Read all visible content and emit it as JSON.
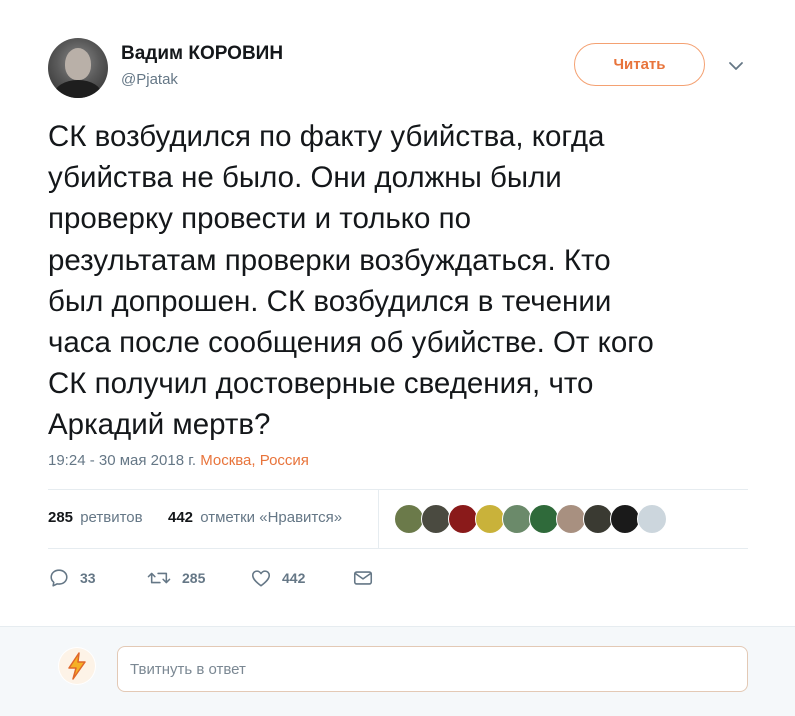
{
  "user": {
    "name": "Вадим КОРОВИН",
    "handle": "@Pjatak"
  },
  "follow_button": {
    "label": "Читать"
  },
  "tweet": {
    "lines": [
      "СК возбудился по факту убийства, когда",
      "убийства не было. Они должны были",
      "проверку провести и только по",
      "результатам проверки возбуждаться. Кто",
      "был допрошен. СК возбудился в течении",
      "часа после сообщения об убийстве. От кого",
      "СК получил достоверные сведения, что",
      "Аркадий мертв?"
    ],
    "timestamp": "19:24 - 30 мая 2018 г.",
    "location": "Москва, Россия"
  },
  "stats": {
    "retweets_count": "285",
    "retweets_label": "ретвитов",
    "likes_count": "442",
    "likes_label": "отметки «Нравится»",
    "liker_avatars": [
      "#6b7a4a",
      "#4a4a40",
      "#8a1a1a",
      "#c9b23a",
      "#6b8a6a",
      "#2f6a3a",
      "#a89080",
      "#3a3a32",
      "#1a1a1a",
      "#ccd6dd"
    ]
  },
  "actions": {
    "reply_count": "33",
    "retweet_count": "285",
    "like_count": "442",
    "icons": [
      "reply-icon",
      "retweet-icon",
      "heart-icon",
      "message-icon"
    ]
  },
  "reply_box": {
    "placeholder": "Твитнуть в ответ"
  },
  "colors": {
    "accent": "#e8743b",
    "muted": "#657786",
    "text": "#14171a"
  }
}
